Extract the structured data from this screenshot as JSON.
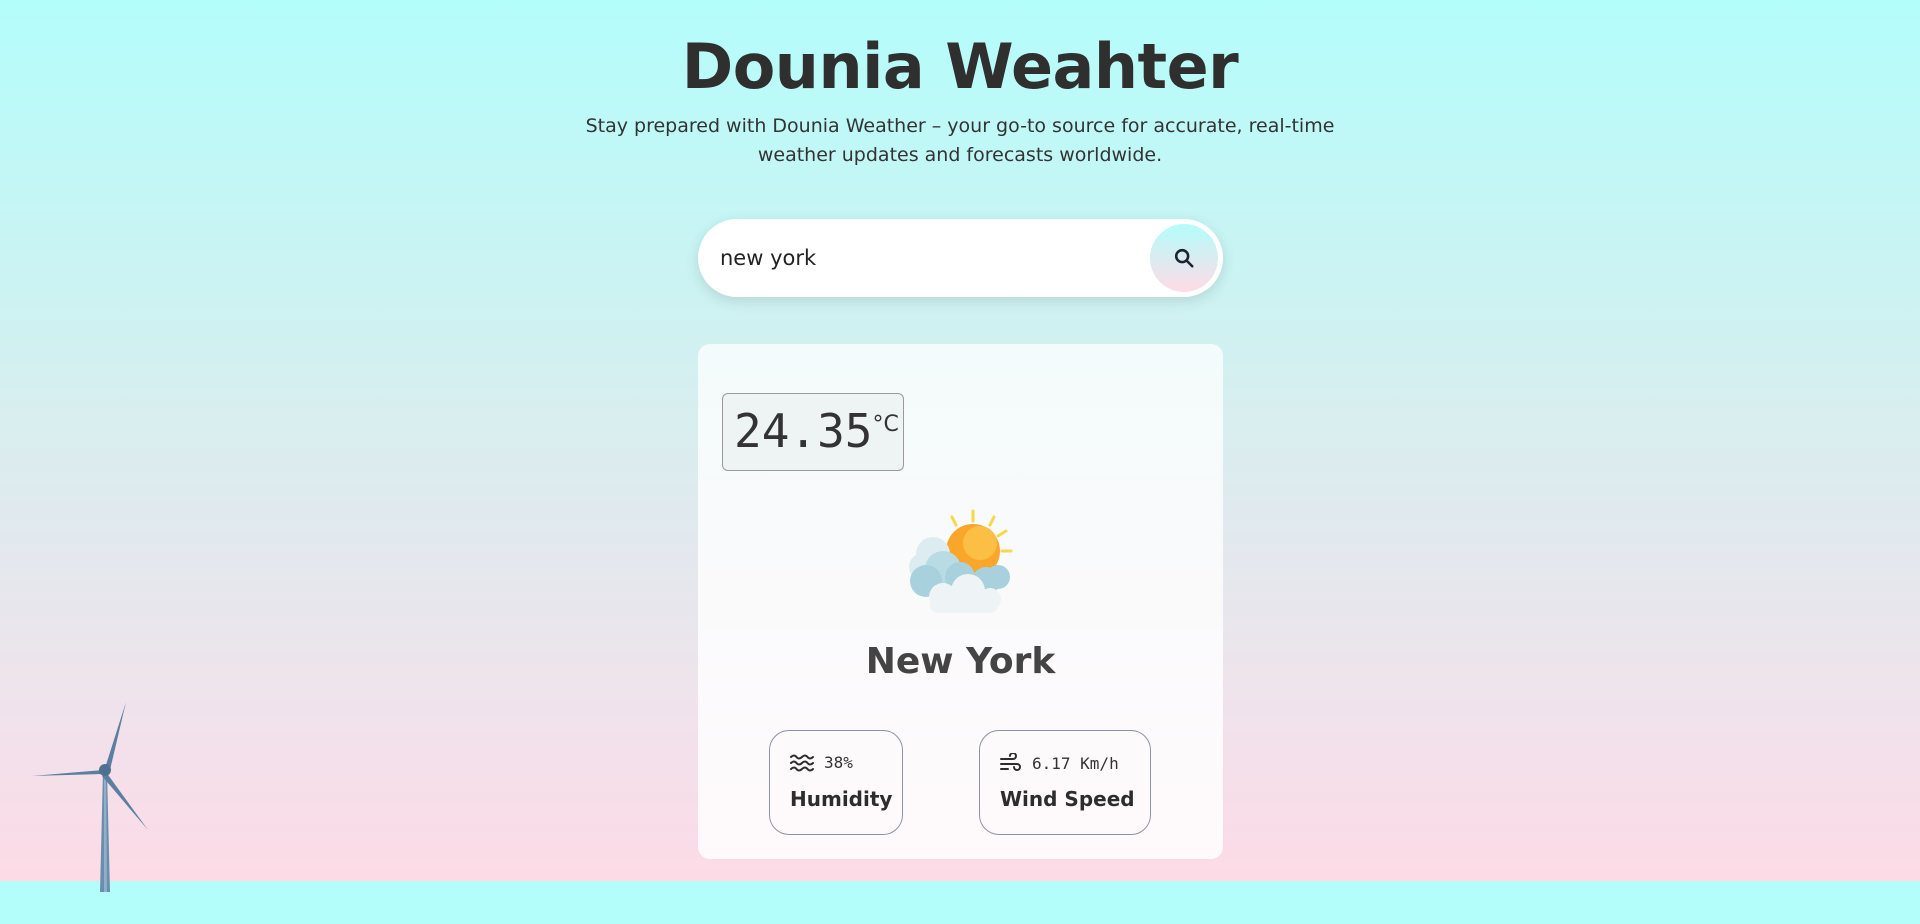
{
  "header": {
    "title": "Dounia Weahter",
    "subtitle": "Stay prepared with Dounia Weather – your go-to source for accurate, real-time weather updates and forecasts worldwide."
  },
  "search": {
    "value": "new york",
    "placeholder": "",
    "button_icon": "search-icon"
  },
  "weather": {
    "temperature": "24.35",
    "unit": "°C",
    "condition_icon": "partly-cloudy-sun-icon",
    "city": "New York",
    "humidity": {
      "value": "38%",
      "label": "Humidity",
      "icon": "waves-icon"
    },
    "wind": {
      "value": "6.17 Km/h",
      "label": "Wind Speed",
      "icon": "wind-icon"
    }
  },
  "decoration": {
    "icon": "wind-turbine-icon"
  },
  "colors": {
    "sky_top": "#b3fdfb",
    "sky_bottom": "#ffd9e5",
    "text_dark": "#2f2f2f",
    "sun": "#f9a62b"
  }
}
